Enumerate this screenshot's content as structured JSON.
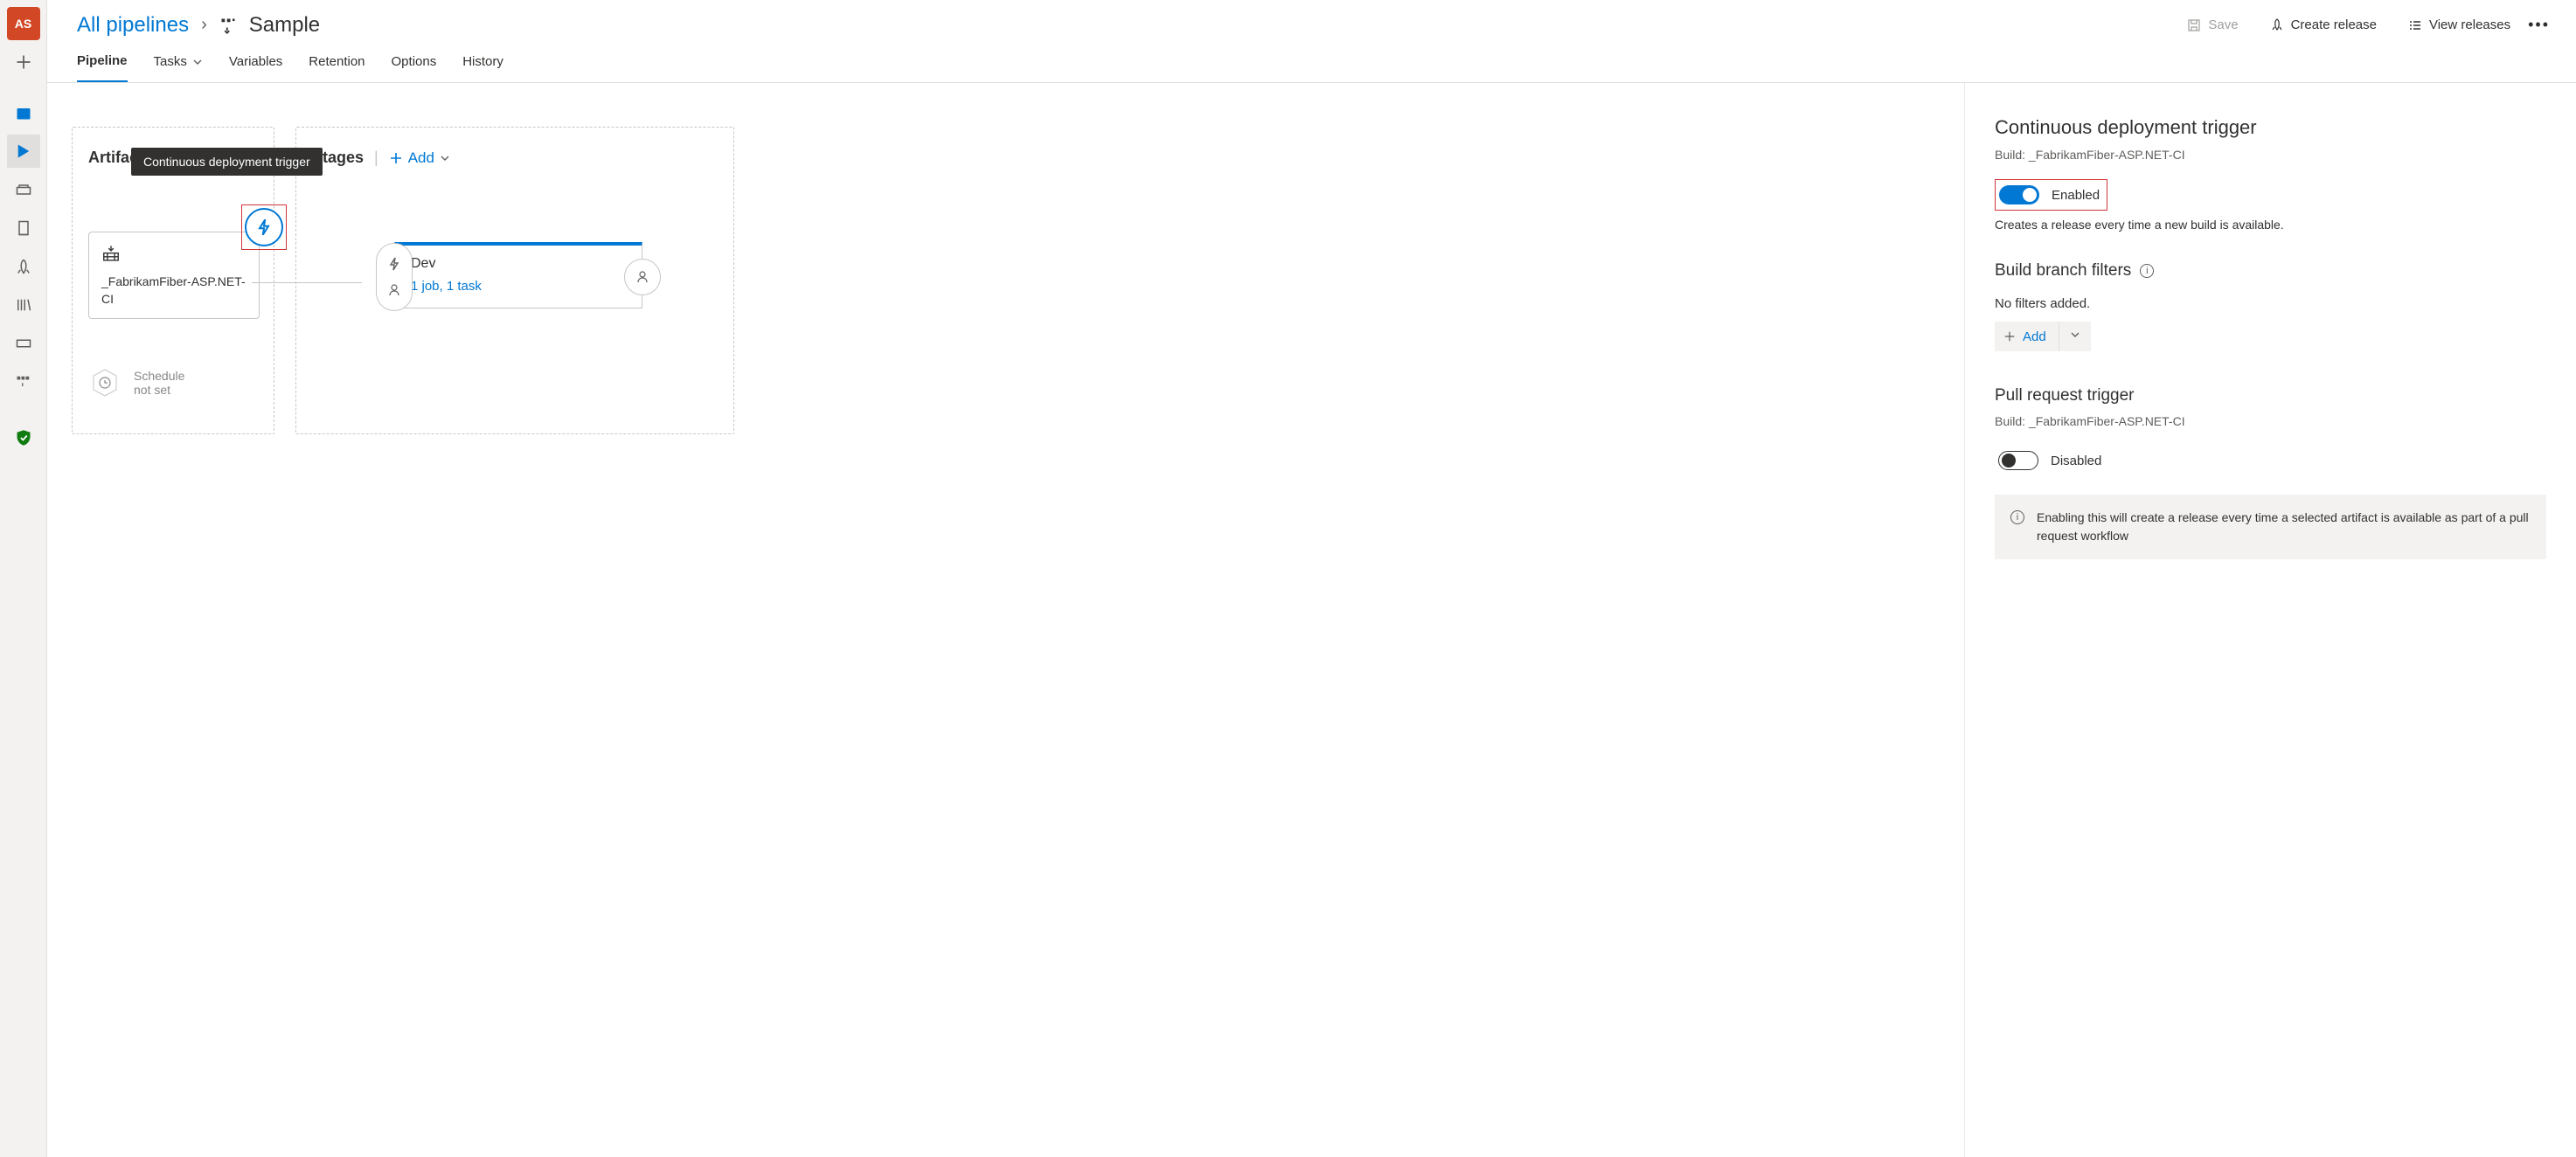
{
  "rail": {
    "avatar": "AS"
  },
  "breadcrumb": {
    "root": "All pipelines",
    "title": "Sample"
  },
  "header_actions": {
    "save": "Save",
    "create_release": "Create release",
    "view_releases": "View releases"
  },
  "tabs": {
    "pipeline": "Pipeline",
    "tasks": "Tasks",
    "variables": "Variables",
    "retention": "Retention",
    "options": "Options",
    "history": "History"
  },
  "canvas": {
    "artifacts_heading": "Artifacts",
    "stages_heading": "Stages",
    "add_label": "Add",
    "tooltip": "Continuous deployment trigger",
    "artifact_name": "_FabrikamFiber-ASP.NET-CI",
    "schedule_line1": "Schedule",
    "schedule_line2": "not set",
    "stage_name": "Dev",
    "stage_sub": "1 job, 1 task"
  },
  "panel": {
    "cd_title": "Continuous deployment trigger",
    "cd_build_label": "Build: _FabrikamFiber-ASP.NET-CI",
    "cd_toggle_label": "Enabled",
    "cd_hint": "Creates a release every time a new build is available.",
    "filters_heading": "Build branch filters",
    "no_filters": "No filters added.",
    "add_filter": "Add",
    "pr_title": "Pull request trigger",
    "pr_build_label": "Build: _FabrikamFiber-ASP.NET-CI",
    "pr_toggle_label": "Disabled",
    "pr_info": "Enabling this will create a release every time a selected artifact is available as part of a pull request workflow"
  }
}
